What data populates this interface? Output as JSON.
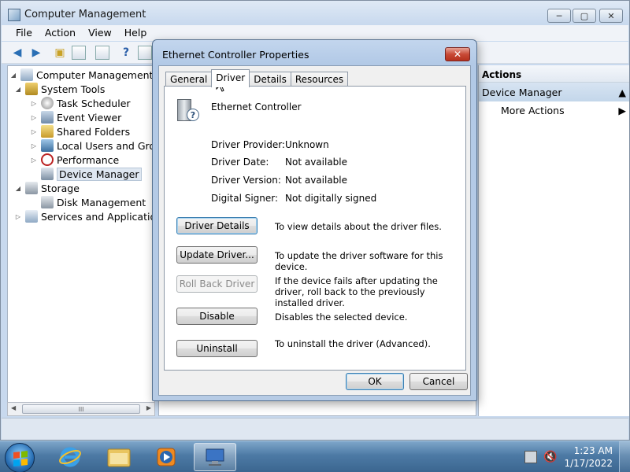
{
  "window": {
    "title": "Computer Management",
    "minimize": "─",
    "maximize": "▢",
    "close": "✕"
  },
  "menu": [
    "File",
    "Action",
    "View",
    "Help"
  ],
  "tree": {
    "root": "Computer Management (Local)",
    "system_tools": "System Tools",
    "task_scheduler": "Task Scheduler",
    "event_viewer": "Event Viewer",
    "shared_folders": "Shared Folders",
    "local_users": "Local Users and Groups",
    "performance": "Performance",
    "device_manager": "Device Manager",
    "storage": "Storage",
    "disk_management": "Disk Management",
    "services": "Services and Applications",
    "scroll_grip": "III"
  },
  "actions": {
    "header": "Actions",
    "section": "Device Manager",
    "more": "More Actions"
  },
  "dialog": {
    "title": "Ethernet Controller Properties",
    "close": "✕",
    "tabs": [
      "General",
      "Driver",
      "Details",
      "Resources"
    ],
    "device_name": "Ethernet Controller",
    "props": {
      "provider_label": "Driver Provider:",
      "provider_value": "Unknown",
      "date_label": "Driver Date:",
      "date_value": "Not available",
      "version_label": "Driver Version:",
      "version_value": "Not available",
      "signer_label": "Digital Signer:",
      "signer_value": "Not digitally signed"
    },
    "buttons": {
      "details": "Driver Details",
      "details_desc": "To view details about the driver files.",
      "update": "Update Driver...",
      "update_desc": "To update the driver software for this device.",
      "rollback": "Roll Back Driver",
      "rollback_desc": "If the device fails after updating the driver, roll back to the previously installed driver.",
      "disable": "Disable",
      "disable_desc": "Disables the selected device.",
      "uninstall": "Uninstall",
      "uninstall_desc": "To uninstall the driver (Advanced)."
    },
    "ok": "OK",
    "cancel": "Cancel"
  },
  "taskbar": {
    "time": "1:23 AM",
    "date": "1/17/2022"
  }
}
